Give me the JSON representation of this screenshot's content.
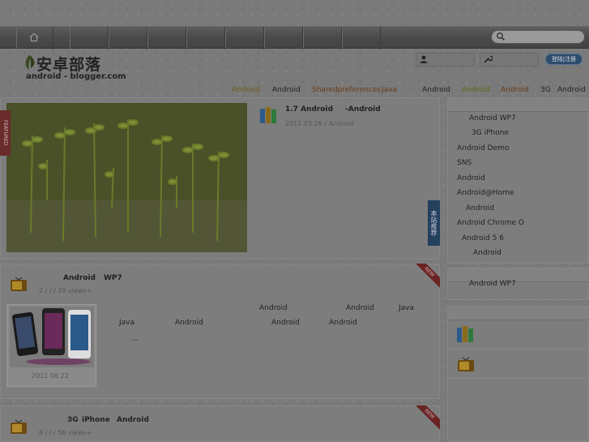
{
  "header": {
    "logo_cn": "安卓部落",
    "logo_en": "android - blogger.com",
    "login_button": "登陆|注册"
  },
  "tags": [
    {
      "label": "Android",
      "color": "#6a5a16"
    },
    {
      "label": "Android",
      "color": "#222222"
    },
    {
      "label": "Sharedpreferences",
      "color": "#6a3a16"
    },
    {
      "label": "Java",
      "color": "#6a3a16"
    },
    {
      "label": "Android",
      "color": "#222222"
    },
    {
      "label": "Android",
      "color": "#5a6a16"
    },
    {
      "label": "Android",
      "color": "#6a3a16"
    },
    {
      "label": "3G",
      "color": "#222222"
    },
    {
      "label": "Android",
      "color": "#222222"
    }
  ],
  "featured": {
    "ribbon": "FEATURED",
    "title_a": "1.7 Android",
    "title_b": "-Android",
    "meta": "2011 03 26  / Android",
    "side_tab": "本站推荐"
  },
  "post1": {
    "title_a": "Android",
    "title_b": "WP7",
    "meta": "2  /  /  /   29 views+",
    "thumb_date": "2011 06 22",
    "new_label": "NEW",
    "lines": [
      [
        "Android",
        "Android",
        "Java"
      ],
      [
        "Java",
        "Android",
        "Android",
        "Android"
      ],
      [
        "..."
      ]
    ]
  },
  "post2": {
    "title_a": "3G",
    "title_b": "iPhone",
    "title_c": "Android",
    "meta": "8  /  /  /   56 views+",
    "new_label": "NEW"
  },
  "sidebar": {
    "list1": [
      "Android    WP7",
      "3G iPhone",
      "Android    Demo",
      "SNS",
      "Android",
      "Android@Home",
      "Android",
      "Android      Chrome O",
      "Android  5      6",
      "Android"
    ],
    "list2": [
      "Android    WP7"
    ]
  }
}
